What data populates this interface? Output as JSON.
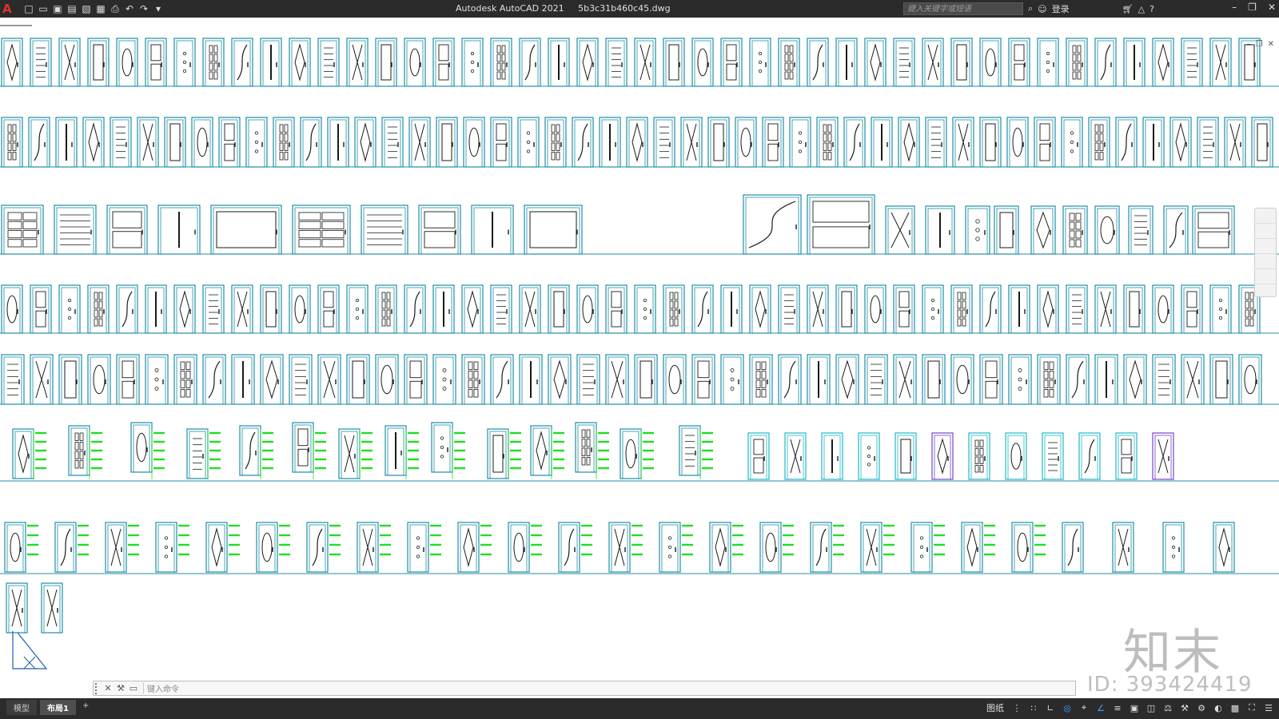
{
  "app": {
    "logo_letter": "A",
    "title_app": "Autodesk AutoCAD 2021",
    "title_file": "5b3c31b460c45.dwg"
  },
  "quick_access": [
    "new-icon",
    "open-icon",
    "save-icon",
    "save-as-icon",
    "plot-preview-icon",
    "publish-icon",
    "print-icon",
    "undo-icon",
    "redo-icon",
    "customize-icon"
  ],
  "search": {
    "placeholder": "键入关键字或短语"
  },
  "account": {
    "label": "登录"
  },
  "window_controls": [
    "minimize-icon",
    "restore-icon",
    "close-icon"
  ],
  "viewport_controls": [
    "minimize-icon",
    "restore-icon",
    "close-icon"
  ],
  "command": {
    "placeholder": "键入命令"
  },
  "layout_tabs": [
    {
      "label": "模型",
      "active": false
    },
    {
      "label": "布局1",
      "active": true
    }
  ],
  "add_tab_label": "+",
  "status": {
    "paper_label": "图纸",
    "icons": [
      "grid-icon",
      "snap-icon",
      "ortho-icon",
      "polar-icon",
      "osnap-icon",
      "otrack-icon",
      "lineweight-icon",
      "transparency-icon",
      "selection-cycling-icon",
      "annotation-scale-icon",
      "workspace-icon",
      "gear-icon",
      "isolate-icon",
      "hardware-accel-icon",
      "fullscreen-icon",
      "menu-icon"
    ]
  },
  "watermark": {
    "logo": "知末",
    "id": "ID: 393424419"
  },
  "colors": {
    "door_outline": "#1f8ea8",
    "door_dark": "#1a1a1a",
    "dimension_green": "#22dd22",
    "accent_purple": "#7744cc",
    "titlebar_bg": "#2b2b2b"
  }
}
